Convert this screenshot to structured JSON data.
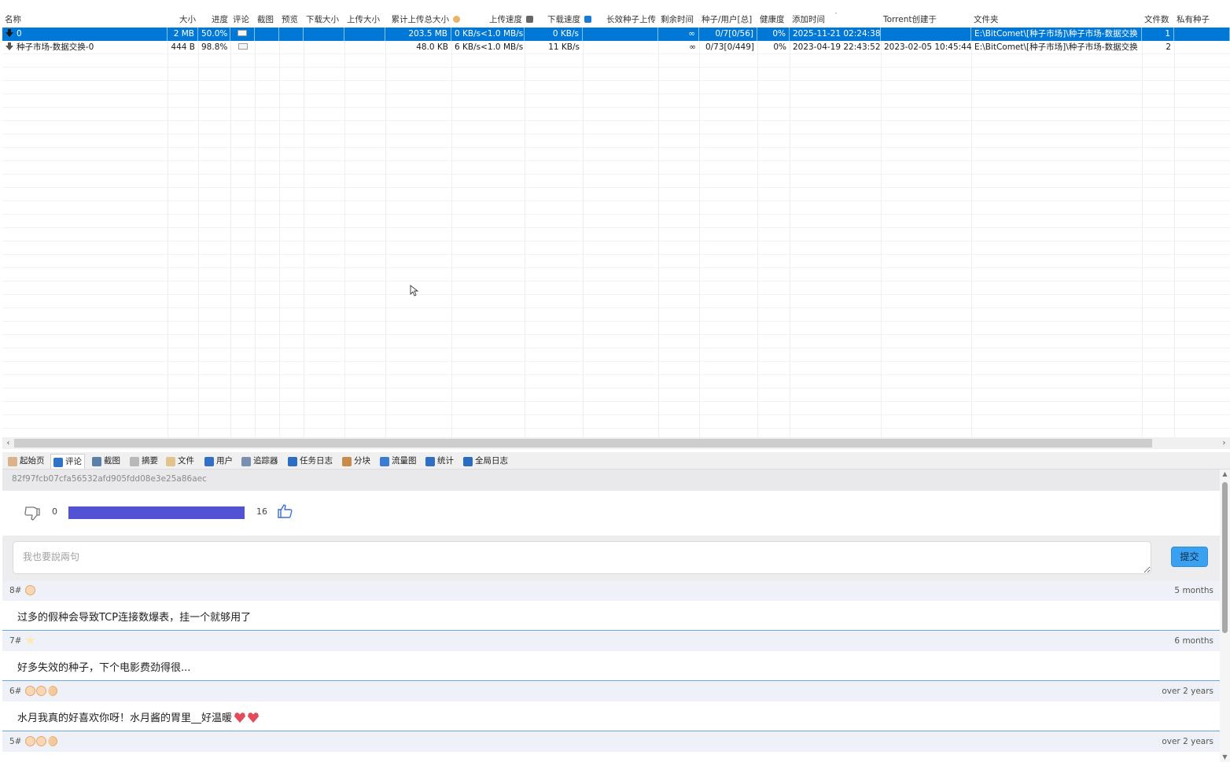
{
  "columns": [
    {
      "label": "名称"
    },
    {
      "label": "大小"
    },
    {
      "label": "进度"
    },
    {
      "label": "评论"
    },
    {
      "label": "截图"
    },
    {
      "label": "预览"
    },
    {
      "label": "下载大小"
    },
    {
      "label": "上传大小"
    },
    {
      "label": "累计上传总大小"
    },
    {
      "label": "上传速度",
      "icon": "upload-speed-icon"
    },
    {
      "label": "下载速度",
      "icon": "download-speed-icon"
    },
    {
      "label": "长效种子上传",
      "icon": "long-seed-upload-icon"
    },
    {
      "label": "剩余时间"
    },
    {
      "label": "种子/用户[总]"
    },
    {
      "label": "健康度"
    },
    {
      "label": "添加时间",
      "sorted": "descending"
    },
    {
      "label": "Torrent创建于"
    },
    {
      "label": "文件夹"
    },
    {
      "label": "文件数"
    },
    {
      "label": "私有种子"
    }
  ],
  "torrents": [
    {
      "selected": true,
      "name": "0",
      "size": "2 MB",
      "progress": "50.0%",
      "progress_fraction": 0.5,
      "has_comment": true,
      "downloaded": "",
      "uploaded": "",
      "total_uploaded": "203.5 MB",
      "upload_speed": "0 KB/s<1.0 MB/s",
      "download_speed": "0 KB/s",
      "long_seed_upload": "",
      "remaining": "∞",
      "seeds_peers": "0/7[0/56]",
      "health": "0%",
      "added": "2025-11-21 02:24:38",
      "created": "",
      "folder": "E:\\BitComet\\[种子市场]\\种子市场-数据交换",
      "file_count": "1",
      "private": ""
    },
    {
      "selected": false,
      "name": "种子市场-数据交换-0",
      "size": "444 B",
      "progress": "98.8%",
      "progress_fraction": 0.988,
      "has_comment": true,
      "downloaded": "",
      "uploaded": "",
      "total_uploaded": "48.0 KB",
      "upload_speed": "6 KB/s<1.0 MB/s",
      "download_speed": "11 KB/s",
      "long_seed_upload": "",
      "remaining": "∞",
      "seeds_peers": "0/73[0/449]",
      "health": "0%",
      "added": "2023-04-19 22:43:52",
      "created": "2023-02-05 10:45:44",
      "folder": "E:\\BitComet\\[种子市场]\\种子市场-数据交换",
      "file_count": "2",
      "private": ""
    }
  ],
  "tabs": [
    {
      "label": "起始页",
      "icon": "home-page-icon",
      "active": false
    },
    {
      "label": "评论",
      "icon": "comment-icon",
      "active": true
    },
    {
      "label": "截图",
      "icon": "screenshot-icon",
      "active": false
    },
    {
      "label": "摘要",
      "icon": "summary-icon",
      "active": false
    },
    {
      "label": "文件",
      "icon": "file-icon",
      "active": false
    },
    {
      "label": "用户",
      "icon": "users-icon",
      "active": false
    },
    {
      "label": "追踪器",
      "icon": "tracker-icon",
      "active": false
    },
    {
      "label": "任务日志",
      "icon": "task-log-icon",
      "active": false
    },
    {
      "label": "分块",
      "icon": "pieces-icon",
      "active": false
    },
    {
      "label": "流量图",
      "icon": "traffic-chart-icon",
      "active": false
    },
    {
      "label": "统计",
      "icon": "statistics-icon",
      "active": false
    },
    {
      "label": "全局日志",
      "icon": "global-log-icon",
      "active": false
    }
  ],
  "comments_panel": {
    "info_hash": "82f97fcb07cfa56532afd905fdd08e3e25a86aec",
    "dislikes": "0",
    "likes": "16",
    "like_fraction": 1.0,
    "input_placeholder": "我也要說兩句",
    "input_value": "",
    "submit_label": "提交",
    "comments": [
      {
        "floor": "8#",
        "badges": [
          "smile-badge"
        ],
        "time": "5 months",
        "text": "过多的假种会导致TCP连接数爆表，挂一个就够用了",
        "hearts": 0
      },
      {
        "floor": "7#",
        "badges": [
          "star-badge"
        ],
        "time": "6 months",
        "text": "好多失效的种子，下个电影费劲得很...",
        "hearts": 0
      },
      {
        "floor": "6#",
        "badges": [
          "smile-badge",
          "smile-badge",
          "moon-badge"
        ],
        "time": "over 2 years",
        "text": "水月我真的好喜欢你呀！水月酱的胃里__好温暖",
        "hearts": 2
      },
      {
        "floor": "5#",
        "badges": [
          "smile-badge",
          "smile-badge",
          "moon-badge"
        ],
        "time": "over 2 years",
        "text": "",
        "hearts": 0
      }
    ]
  },
  "colors": {
    "selection": "#0078d7",
    "vote_bar": "#5153d4",
    "submit_button": "#3aa0f0",
    "comment_divider": "#6aa6e4"
  }
}
